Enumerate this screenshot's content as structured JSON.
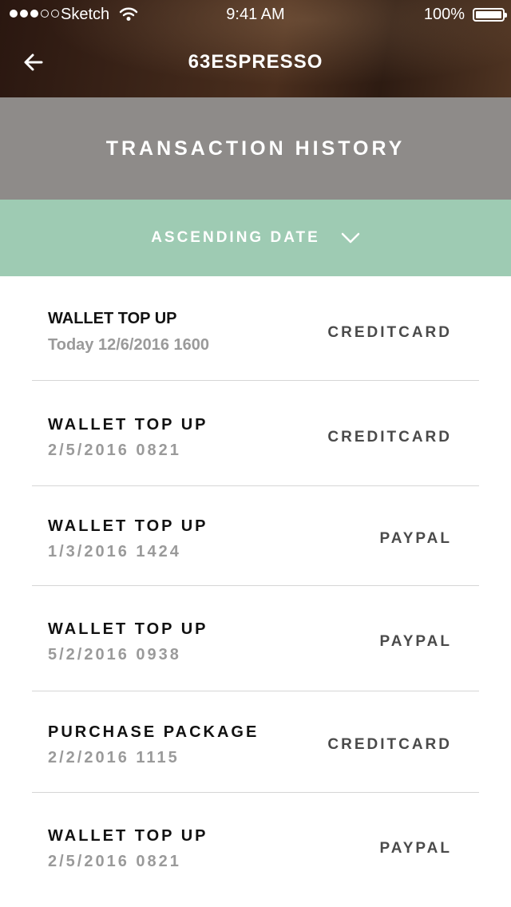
{
  "status_bar": {
    "carrier": "Sketch",
    "time": "9:41 AM",
    "battery": "100%"
  },
  "nav": {
    "title": "63ESPRESSO",
    "back_icon": "arrow-left-icon"
  },
  "header": {
    "title": "TRANSACTION HISTORY"
  },
  "sort": {
    "label": "ASCENDING DATE",
    "icon": "chevron-down-icon"
  },
  "transactions": [
    {
      "type": "WALLET TOP UP",
      "date": "Today 12/6/2016 1600",
      "method": "CREDITCARD"
    },
    {
      "type": "WALLET TOP UP",
      "date": "2/5/2016 0821",
      "method": "CREDITCARD"
    },
    {
      "type": "WALLET TOP UP",
      "date": "1/3/2016 1424",
      "method": "PAYPAL"
    },
    {
      "type": "WALLET TOP UP",
      "date": "5/2/2016 0938",
      "method": "PAYPAL"
    },
    {
      "type": "PURCHASE PACKAGE",
      "date": "2/2/2016 1115",
      "method": "CREDITCARD"
    },
    {
      "type": "WALLET TOP UP",
      "date": "2/5/2016 0821",
      "method": "PAYPAL"
    }
  ]
}
